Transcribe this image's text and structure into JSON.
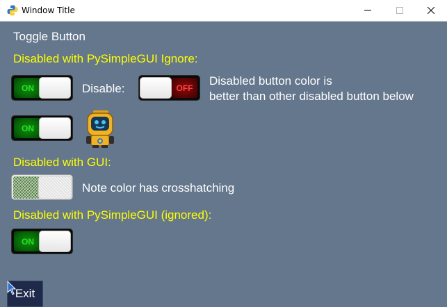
{
  "window": {
    "title": "Window Title",
    "icons": {
      "app": "python-icon",
      "minimize": "minimize-icon",
      "maximize": "maximize-icon",
      "close": "close-icon"
    }
  },
  "main": {
    "heading": "Toggle Button",
    "section1_label": "Disabled with PySimpleGUI Ignore:",
    "disable_label": "Disable:",
    "note1_line1": "Disabled button color is",
    "note1_line2": "better than other disabled button below",
    "section2_label": "Disabled with GUI:",
    "note2": "Note color has crosshatching",
    "section3_label": "Disabled with PySimpleGUI (ignored):",
    "exit_label": "Exit"
  },
  "toggles": {
    "on_text": "ON",
    "off_text": "OFF"
  },
  "colors": {
    "background": "#64778d",
    "label_yellow": "#ffff00",
    "on_green": "#066606",
    "off_red": "#5e0404",
    "exit_bg": "#1f2a4a"
  }
}
